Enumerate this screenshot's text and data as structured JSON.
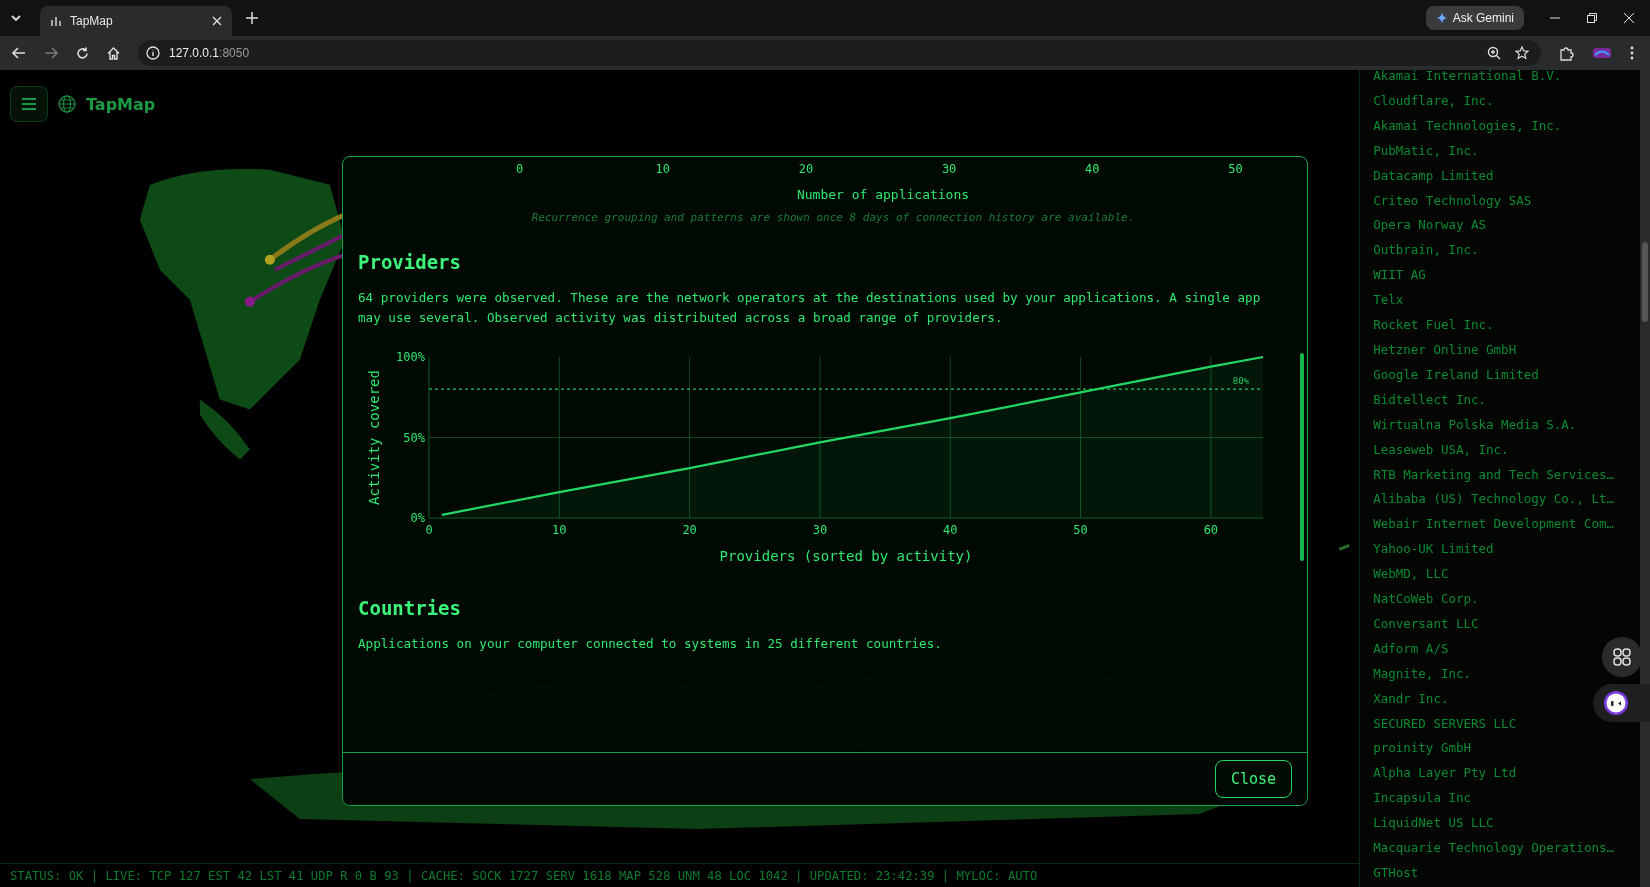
{
  "browser": {
    "tab_title": "TapMap",
    "ask_button": "Ask Gemini",
    "address": {
      "host": "127.0.0.1",
      "port": ":8050"
    }
  },
  "app": {
    "title": "TapMap"
  },
  "dialog": {
    "upper_axis": {
      "ticks": [
        "0",
        "10",
        "20",
        "30",
        "40",
        "50"
      ],
      "label": "Number of applications"
    },
    "note": "Recurrence grouping and patterns are shown once 8 days of connection history are available.",
    "sections": [
      {
        "heading": "Providers",
        "text": "64 providers were observed. These are the network operators at the destinations used by your applications. A single app may use several. Observed activity was distributed across a broad range of providers.",
        "chart_data": {
          "type": "area",
          "xlabel": "Providers (sorted by activity)",
          "ylabel": "Activity covered",
          "x": [
            1,
            10,
            20,
            30,
            40,
            50,
            60,
            64
          ],
          "values": [
            2,
            16,
            31,
            47,
            62,
            78,
            94,
            100
          ],
          "grid": true,
          "xlim": [
            0,
            64
          ],
          "ylim": [
            0,
            100
          ],
          "xticks": [
            0,
            10,
            20,
            30,
            40,
            50,
            60
          ],
          "yticks": [
            {
              "value": 0,
              "label": "0%"
            },
            {
              "value": 50,
              "label": "50%"
            },
            {
              "value": 100,
              "label": "100%"
            }
          ],
          "ref_lines": [
            {
              "axis": "y",
              "value": 80,
              "label": "80%"
            }
          ]
        }
      },
      {
        "heading": "Countries",
        "text": "Applications on your computer connected to systems in 25 different countries."
      }
    ],
    "close_button": "Close"
  },
  "sidebar": {
    "items": [
      "Akamai International B.V.",
      "Cloudflare, Inc.",
      "Akamai Technologies, Inc.",
      "PubMatic, Inc.",
      "Datacamp Limited",
      "Criteo Technology SAS",
      "Opera Norway AS",
      "Outbrain, Inc.",
      "WIIT AG",
      "Telx",
      "Rocket Fuel Inc.",
      "Hetzner Online GmbH",
      "Google Ireland Limited",
      "Bidtellect Inc.",
      "Wirtualna Polska Media S.A.",
      "Leaseweb USA, Inc.",
      "RTB Marketing and Tech Services…",
      "Alibaba (US) Technology Co., Lt…",
      "Webair Internet Development Com…",
      "Yahoo-UK Limited",
      "WebMD, LLC",
      "NatCoWeb Corp.",
      "Conversant LLC",
      "Adform A/S",
      "Magnite, Inc.",
      "Xandr Inc.",
      "SECURED SERVERS LLC",
      "proinity GmbH",
      "Alpha Layer Pty Ltd",
      "Incapsula Inc",
      "LiquidNet US LLC",
      "Macquarie Technology Operations…",
      "GTHost"
    ]
  },
  "status_bar": "STATUS: OK | LIVE: TCP 127 EST 42 LST 41 UDP R 0 B 93 | CACHE: SOCK 1727 SERV 1618 MAP 528 UNM 48 LOC 1042 | UPDATED: 23:42:39 | MYLOC: AUTO"
}
